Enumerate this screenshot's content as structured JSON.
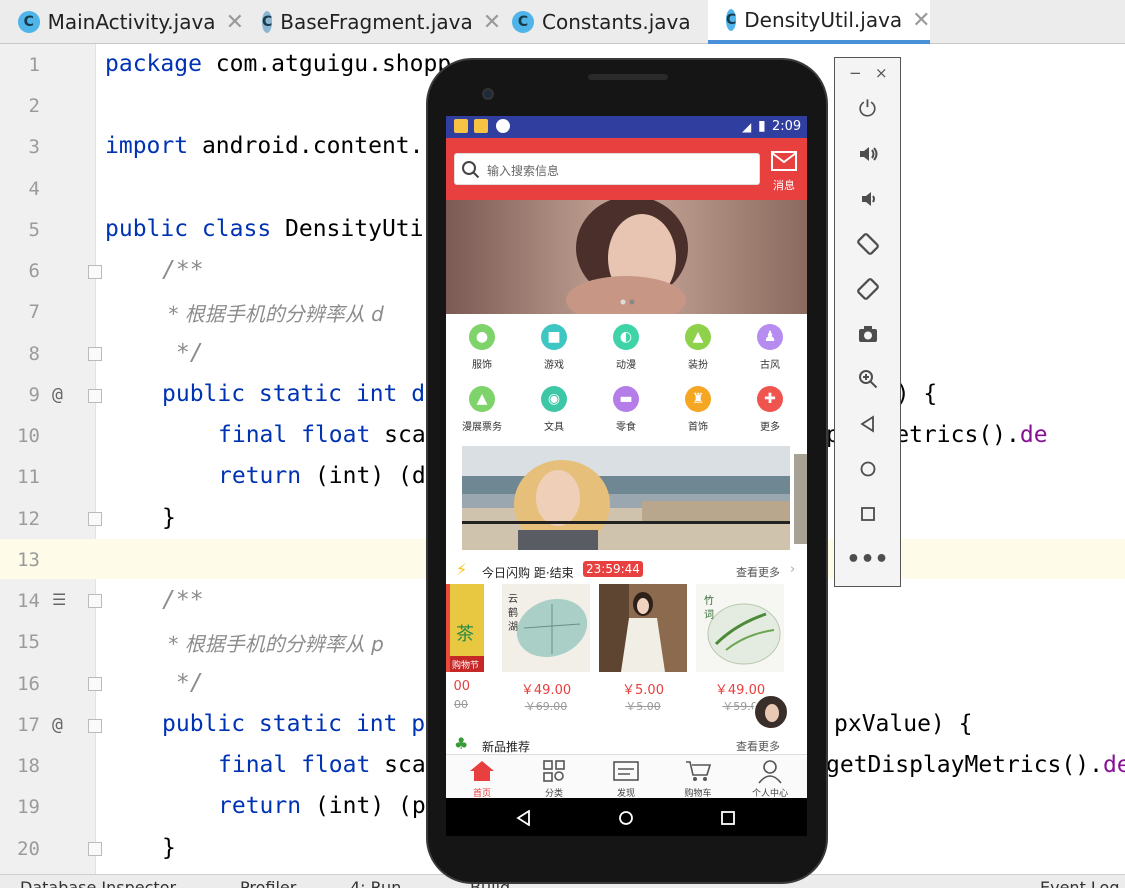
{
  "tabs": [
    {
      "name": "MainActivity.java",
      "icon": "class-icon"
    },
    {
      "name": "BaseFragment.java",
      "icon": "class-icon"
    },
    {
      "name": "Constants.java",
      "icon": "class-icon"
    },
    {
      "name": "DensityUtil.java",
      "icon": "class-icon",
      "active": true
    }
  ],
  "tab_close_glyph": "✕",
  "line_numbers": [
    "1",
    "2",
    "3",
    "4",
    "5",
    "6",
    "7",
    "8",
    "9",
    "10",
    "11",
    "12",
    "13",
    "14",
    "15",
    "16",
    "17",
    "18",
    "19",
    "20"
  ],
  "gutter_marks": {
    "at9": "@",
    "at17": "@"
  },
  "code": {
    "l1_kw": "package",
    "l1_rest": " com.atguigu.shopp",
    "l3_kw": "import",
    "l3_rest": " android.content.",
    "l5_kw": "public class",
    "l5_rest": " DensityUti",
    "l6": "/**",
    "l7": " * 根据手机的分辨率从 d",
    "l8": " */",
    "l9_kw": "public static int",
    "l9_rest": " d",
    "l9_right": "ue) {",
    "l10_kw": "final float",
    "l10_rest": " sca",
    "l10_right": "playMetrics().",
    "l10_pl": "de",
    "l11_kw": "return",
    "l11_rest": " (int) (d",
    "l12": "}",
    "l14": "/**",
    "l15": " * 根据手机的分辨率从 p",
    "l16": " */",
    "l17_kw": "public static int",
    "l17_rest": " p",
    "l17_right": "pxValue) {",
    "l18_kw": "final float",
    "l18_rest": " sca",
    "l18_right": "getDisplayMetrics().",
    "l18_pl": "de",
    "l19_kw": "return",
    "l19_rest": " (int) (p",
    "l20": "}"
  },
  "statusbar": {
    "items": [
      "Database Inspector",
      "Profiler",
      "4: Run",
      "Build",
      "Event Log"
    ]
  },
  "emulator": {
    "minimize": "−",
    "close": "×",
    "buttons": [
      "power-icon",
      "volume-up-icon",
      "volume-down-icon",
      "rotate-left-icon",
      "rotate-right-icon",
      "camera-icon",
      "zoom-icon",
      "back-icon",
      "home-icon",
      "overview-icon",
      "more-icon"
    ]
  },
  "phone": {
    "time": "2:09",
    "battery": "▮",
    "search_placeholder": "输入搜索信息",
    "message_label": "消息",
    "categories_row1": [
      {
        "name": "服饰",
        "color": "#7ed36b"
      },
      {
        "name": "游戏",
        "color": "#3ec7c2"
      },
      {
        "name": "动漫",
        "color": "#3ed4a8"
      },
      {
        "name": "装扮",
        "color": "#8ed14a"
      },
      {
        "name": "古风",
        "color": "#b78cf0"
      }
    ],
    "categories_row2": [
      {
        "name": "漫展票务",
        "color": "#7ed36b"
      },
      {
        "name": "文具",
        "color": "#3ec7a6"
      },
      {
        "name": "零食",
        "color": "#b47de8"
      },
      {
        "name": "首饰",
        "color": "#f5a623"
      },
      {
        "name": "更多",
        "color": "#f0544f"
      }
    ],
    "flash_sale": {
      "title": "今日闪购 距·结束",
      "countdown": "23:59:44",
      "see_more": "查看更多"
    },
    "products": [
      {
        "price": "00",
        "old": "00"
      },
      {
        "price": "￥49.00",
        "old": "￥69.00"
      },
      {
        "price": "￥5.00",
        "old": "￥5.00"
      },
      {
        "price": "￥49.00",
        "old": "￥59.0"
      }
    ],
    "product_labels": [
      "茶",
      "购物节",
      "云",
      "鹤",
      "湖",
      "竹",
      "词"
    ],
    "recommend": {
      "title": "新品推荐",
      "see_more": "查看更多"
    },
    "bottom_nav": [
      {
        "label": "首页",
        "icon": "home-icon",
        "active": true
      },
      {
        "label": "分类",
        "icon": "category-icon"
      },
      {
        "label": "发现",
        "icon": "discover-icon"
      },
      {
        "label": "购物车",
        "icon": "cart-icon"
      },
      {
        "label": "个人中心",
        "icon": "profile-icon"
      }
    ]
  }
}
